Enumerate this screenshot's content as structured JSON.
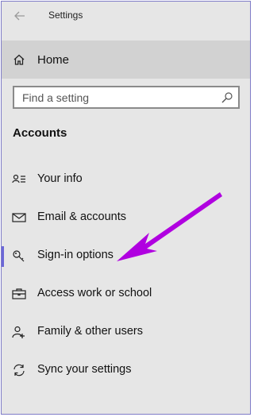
{
  "window": {
    "title": "Settings"
  },
  "home": {
    "label": "Home"
  },
  "search": {
    "placeholder": "Find a setting"
  },
  "section": {
    "title": "Accounts"
  },
  "nav": {
    "items": [
      {
        "label": "Your info",
        "icon": "person-card-icon"
      },
      {
        "label": "Email & accounts",
        "icon": "mail-icon"
      },
      {
        "label": "Sign-in options",
        "icon": "key-icon",
        "selected": true
      },
      {
        "label": "Access work or school",
        "icon": "briefcase-icon"
      },
      {
        "label": "Family & other users",
        "icon": "add-person-icon"
      },
      {
        "label": "Sync your settings",
        "icon": "sync-icon"
      }
    ]
  },
  "colors": {
    "window_bg": "#e6e6e6",
    "home_bg": "#d2d2d2",
    "accent": "#6b67d6",
    "annotation_arrow": "#b000e0"
  }
}
